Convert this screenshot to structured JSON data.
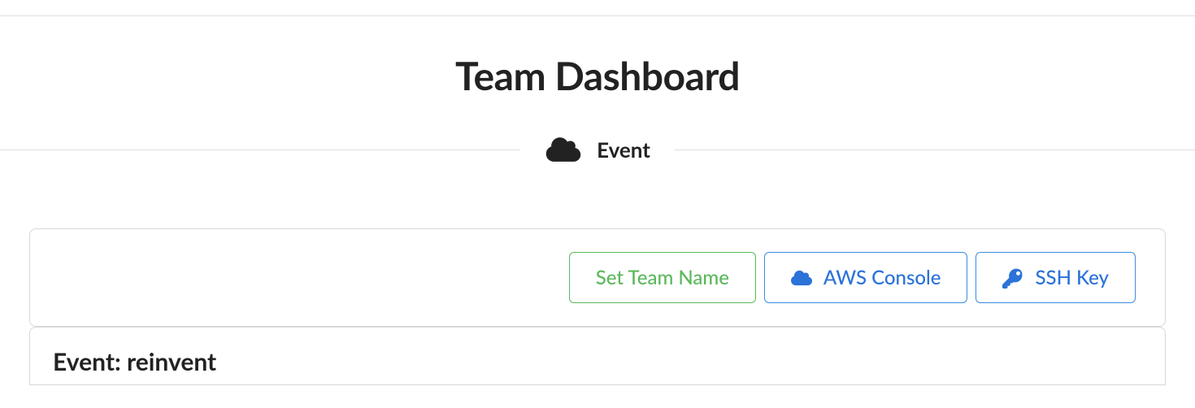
{
  "header": {
    "title": "Team Dashboard"
  },
  "section": {
    "label": "Event",
    "icon": "cloud-icon"
  },
  "buttons": {
    "set_team_name": "Set Team Name",
    "aws_console": "AWS Console",
    "ssh_key": "SSH Key"
  },
  "event": {
    "label_prefix": "Event:",
    "name": "reinvent",
    "full": "Event: reinvent"
  },
  "colors": {
    "green": "#5cb85c",
    "blue": "#2b72d9",
    "border": "#d8d8d8",
    "text": "#222222"
  }
}
